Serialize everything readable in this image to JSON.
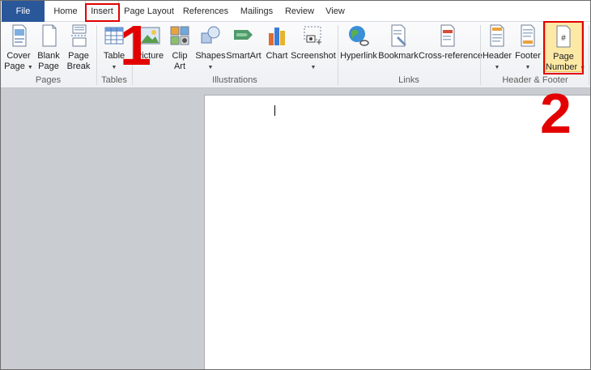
{
  "tabs": [
    {
      "label": "File"
    },
    {
      "label": "Home"
    },
    {
      "label": "Insert"
    },
    {
      "label": "Page Layout"
    },
    {
      "label": "References"
    },
    {
      "label": "Mailings"
    },
    {
      "label": "Review"
    },
    {
      "label": "View"
    }
  ],
  "ribbon": {
    "pages": {
      "label": "Pages",
      "cover_page": "Cover Page",
      "cover_line1": "Cover",
      "cover_line2": "Page",
      "blank_line1": "Blank",
      "blank_line2": "Page",
      "break_line1": "Page",
      "break_line2": "Break"
    },
    "tables": {
      "label": "Tables",
      "table": "Table"
    },
    "illustrations": {
      "label": "Illustrations",
      "picture": "Picture",
      "clip_line1": "Clip",
      "clip_line2": "Art",
      "shapes": "Shapes",
      "smartart": "SmartArt",
      "chart": "Chart",
      "screenshot": "Screenshot"
    },
    "links": {
      "label": "Links",
      "hyperlink": "Hyperlink",
      "bookmark": "Bookmark",
      "crossref": "Cross-reference"
    },
    "header_footer": {
      "label": "Header & Footer",
      "header": "Header",
      "footer": "Footer",
      "pagenum_line1": "Page",
      "pagenum_line2": "Number"
    }
  },
  "annotations": {
    "step1": "1",
    "step2": "2"
  },
  "colors": {
    "file_tab": "#2a579a",
    "highlight": "#e30000",
    "workspace": "#c9ccd1"
  },
  "icons": [
    "cover-page-icon",
    "blank-page-icon",
    "page-break-icon",
    "table-icon",
    "picture-icon",
    "clip-art-icon",
    "shapes-icon",
    "smartart-icon",
    "chart-icon",
    "screenshot-icon",
    "hyperlink-icon",
    "bookmark-icon",
    "cross-reference-icon",
    "header-icon",
    "footer-icon",
    "page-number-icon"
  ]
}
